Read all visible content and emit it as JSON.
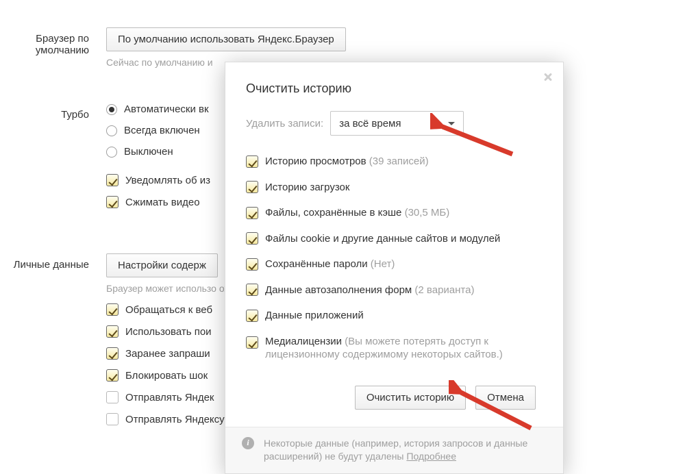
{
  "settings": {
    "default_browser": {
      "label": "Браузер по умолчанию",
      "button": "По умолчанию использовать Яндекс.Браузер",
      "note": "Сейчас по умолчанию и"
    },
    "turbo": {
      "label": "Турбо",
      "options": {
        "auto": "Автоматически вк",
        "always": "Всегда включен",
        "off": "Выключен"
      },
      "notify": "Уведомлять об из",
      "compress_video": "Сжимать видео"
    },
    "personal": {
      "label": "Личные данные",
      "button": "Настройки содерж",
      "desc": "Браузер может использо                                                                                                                                                                        ожности вам не нужны, их можно отк",
      "items": {
        "webservice": "Обращаться к веб",
        "search": "Использовать пои",
        "prefetch": "Заранее запраши",
        "block": "Блокировать шок",
        "send1": "Отправлять Яндек",
        "send2": "Отправлять Яндексу отчеты о сбоях"
      }
    }
  },
  "modal": {
    "title": "Очистить историю",
    "time_label": "Удалить записи:",
    "time_selected": "за всё время",
    "items": {
      "browsing": {
        "label": "Историю просмотров ",
        "extra": "(39 записей)"
      },
      "downloads": {
        "label": "Историю загрузок"
      },
      "cache": {
        "label": "Файлы, сохранённые в кэше ",
        "extra": "(30,5 МБ)"
      },
      "cookies": {
        "label": "Файлы cookie и другие данные сайтов и модулей"
      },
      "passwords": {
        "label": "Сохранённые пароли ",
        "extra": "(Нет)"
      },
      "autofill": {
        "label": "Данные автозаполнения форм ",
        "extra": "(2 варианта)"
      },
      "appdata": {
        "label": "Данные приложений"
      },
      "media": {
        "label": "Медиалицензии ",
        "extra": "(Вы можете потерять доступ к лицензионному содержимому некоторых сайтов.)"
      }
    },
    "actions": {
      "clear": "Очистить историю",
      "cancel": "Отмена"
    },
    "footer": {
      "text": "Некоторые данные (например, история запросов и данные расширений) не будут удалены ",
      "link": "Подробнее"
    }
  }
}
